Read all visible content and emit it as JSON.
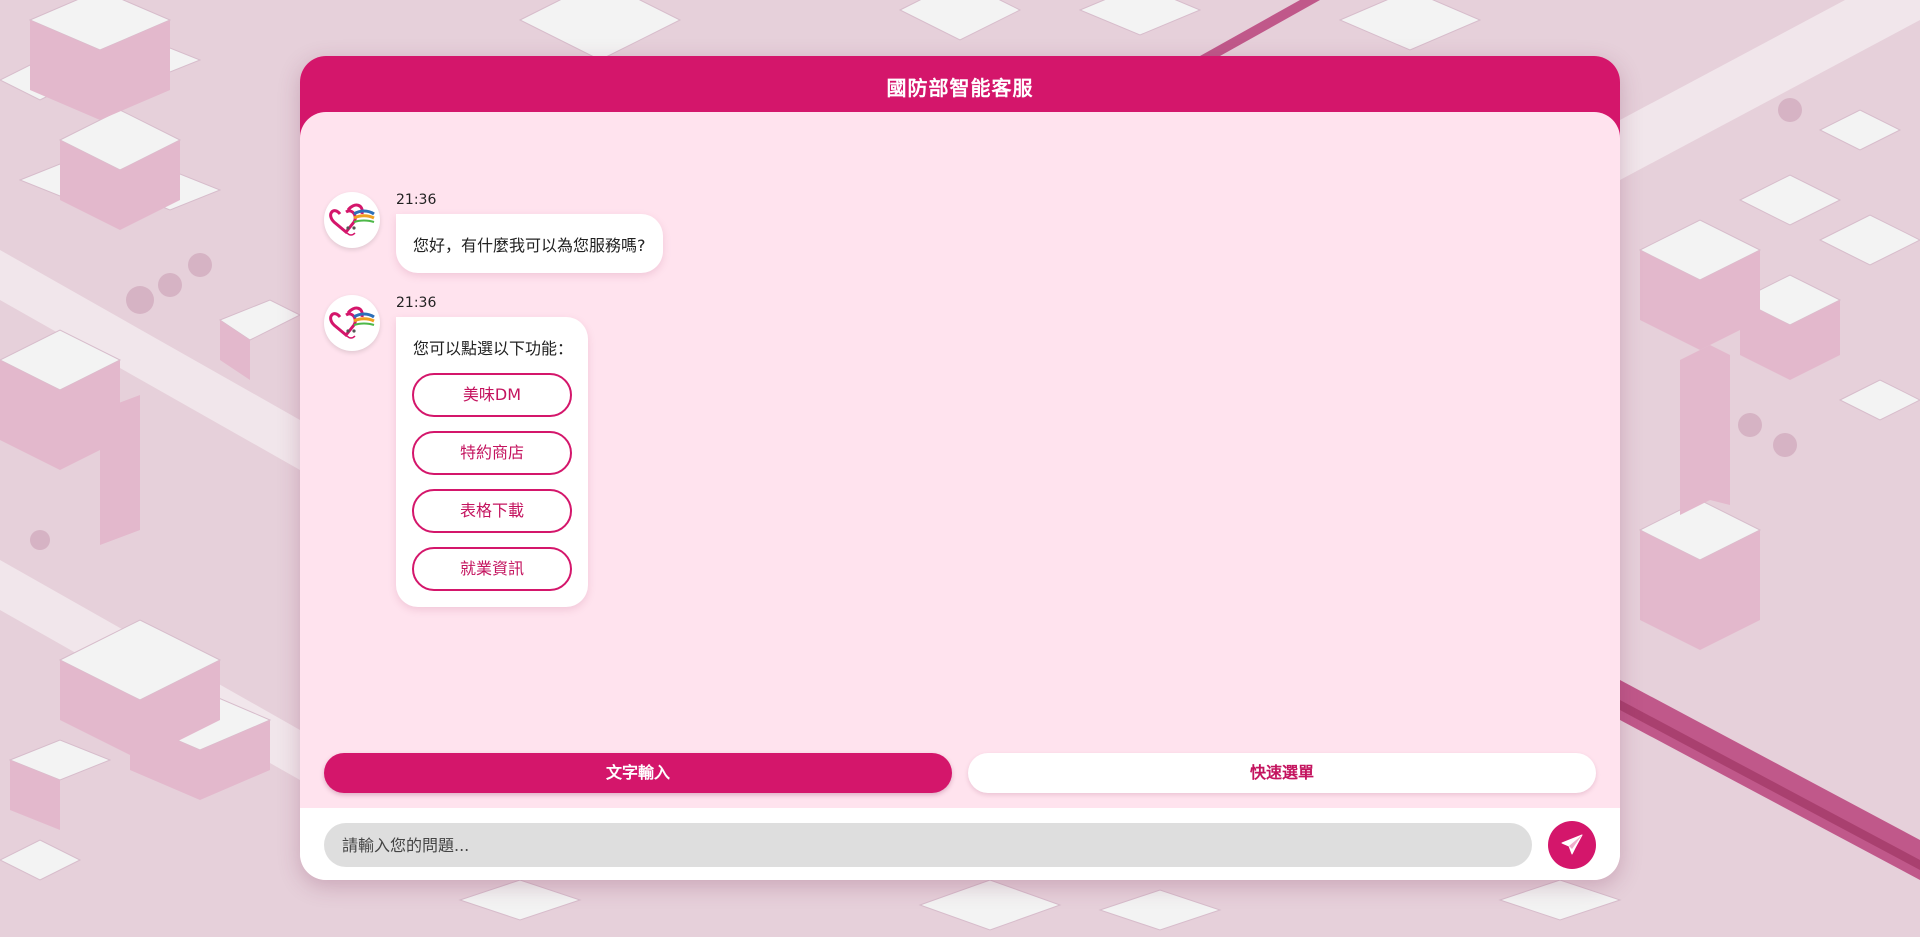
{
  "header": {
    "title": "國防部智能客服"
  },
  "messages": [
    {
      "time": "21:36",
      "text": "您好，有什麼我可以為您服務嗎?"
    },
    {
      "time": "21:36",
      "text": "您可以點選以下功能：",
      "options": [
        "美味DM",
        "特約商店",
        "表格下載",
        "就業資訊"
      ]
    }
  ],
  "mode_switch": {
    "text_input_label": "文字輸入",
    "quick_menu_label": "快速選單",
    "active": "text_input"
  },
  "input": {
    "placeholder": "請輸入您的問題...",
    "value": ""
  },
  "colors": {
    "primary": "#d4166b",
    "panel": "#ffe3ee",
    "background": "#e9d3dd"
  },
  "icons": {
    "avatar": "heart-logo-icon",
    "send": "paper-plane-icon"
  }
}
